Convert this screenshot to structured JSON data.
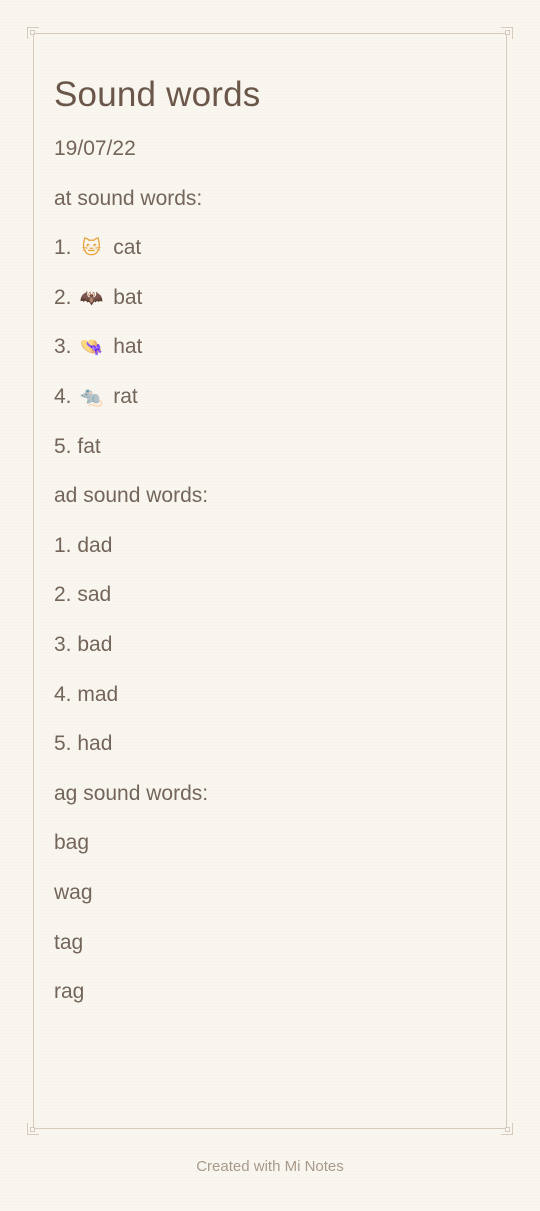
{
  "note": {
    "title": "Sound words",
    "date": "19/07/22",
    "sections": [
      {
        "heading": "at sound words:",
        "items": [
          {
            "prefix": "1.",
            "icon": "cat-emoji",
            "glyph": "🐱",
            "word": "cat"
          },
          {
            "prefix": "2.",
            "icon": "bat-emoji",
            "glyph": "🦇",
            "word": "bat"
          },
          {
            "prefix": "3.",
            "icon": "hat-emoji",
            "glyph": "👒",
            "word": "hat"
          },
          {
            "prefix": "4.",
            "icon": "rat-emoji",
            "glyph": "🐀",
            "word": "rat"
          },
          {
            "prefix": "5.",
            "word": "fat"
          }
        ]
      },
      {
        "heading": "ad sound words:",
        "items": [
          {
            "prefix": "1.",
            "word": "dad"
          },
          {
            "prefix": "2.",
            "word": "sad"
          },
          {
            "prefix": "3.",
            "word": "bad"
          },
          {
            "prefix": "4.",
            "word": "mad"
          },
          {
            "prefix": "5.",
            "word": "had"
          }
        ]
      },
      {
        "heading": "ag sound words:",
        "items": [
          {
            "word": "bag"
          },
          {
            "word": "wag"
          },
          {
            "word": "tag"
          },
          {
            "word": "rag"
          }
        ]
      }
    ]
  },
  "footer": {
    "text": "Created with Mi Notes"
  },
  "colors": {
    "background": "#f9f6ef",
    "text": "#74655a",
    "frame": "#d6cabd",
    "footer": "#a8998b"
  }
}
